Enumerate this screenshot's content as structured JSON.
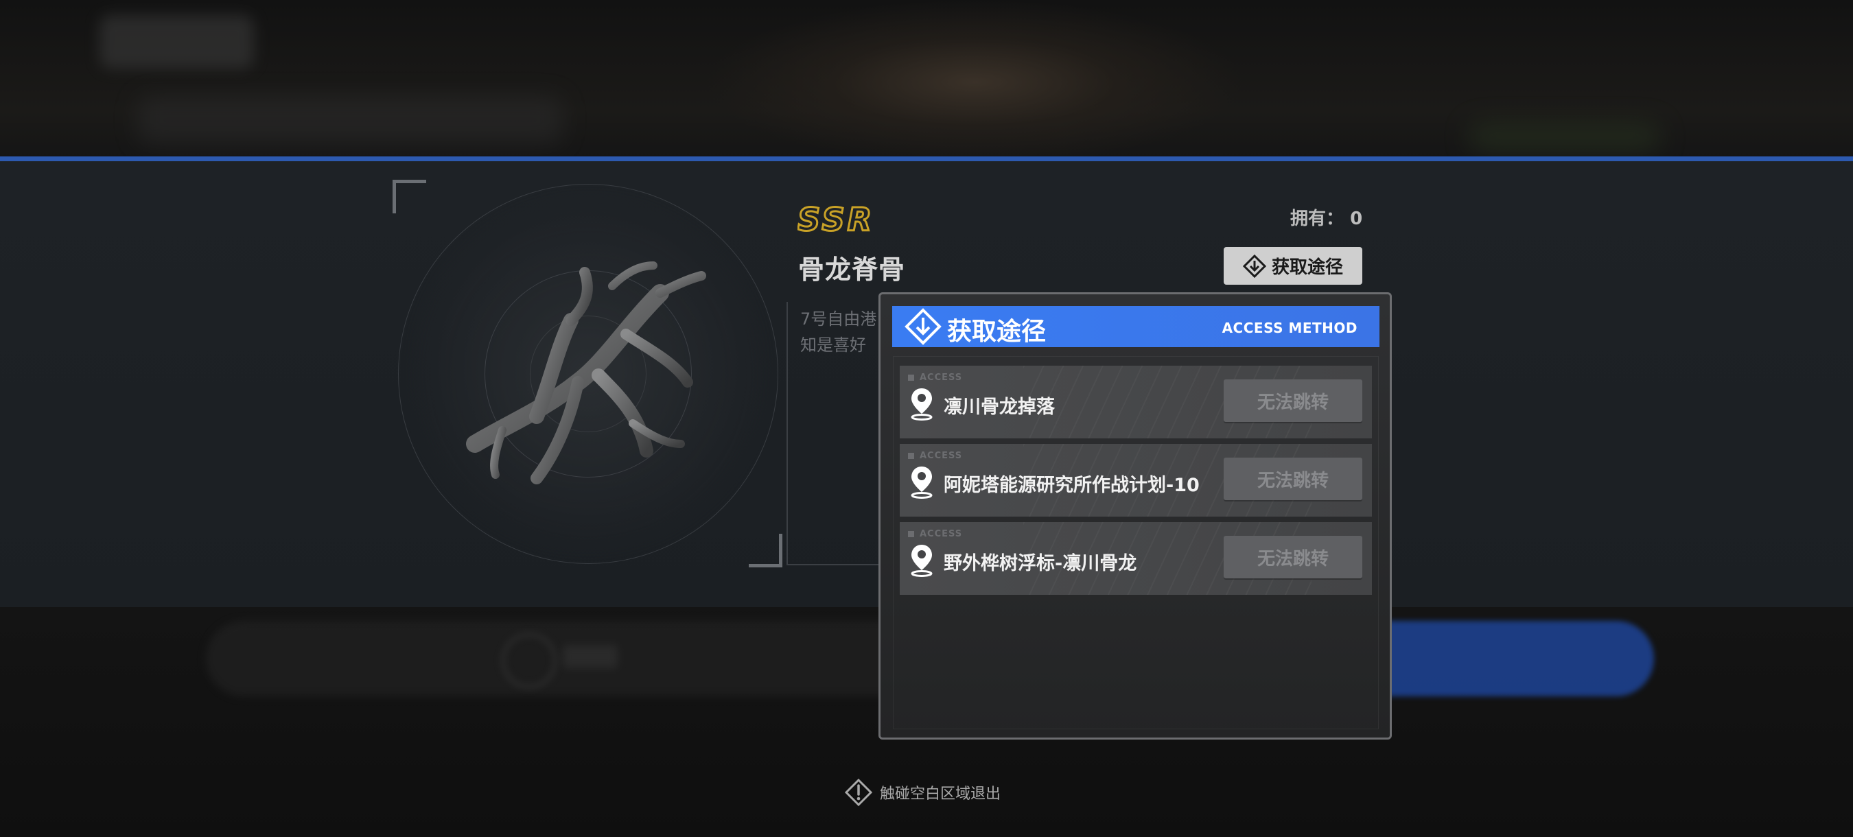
{
  "item": {
    "rarity": "SSR",
    "name": "骨龙脊骨",
    "owned_label": "拥有：",
    "owned_count": "0",
    "description_lines": [
      "7号自由港",
      "知是喜好"
    ],
    "access_button_label": "获取途径"
  },
  "popup": {
    "title": "获取途径",
    "subtitle": "ACCESS METHOD",
    "sources": [
      {
        "tag": "ACCESS",
        "label": "凛川骨龙掉落",
        "button": "无法跳转"
      },
      {
        "tag": "ACCESS",
        "label": "阿妮塔能源研究所作战计划-10",
        "button": "无法跳转"
      },
      {
        "tag": "ACCESS",
        "label": "野外桦树浮标-凛川骨龙",
        "button": "无法跳转"
      }
    ]
  },
  "footer": {
    "exit_hint": "触碰空白区域退出"
  },
  "colors": {
    "accent_blue": "#3a7cf2",
    "rarity_gold": "#c9a227",
    "divider_blue": "#2d5ab0"
  },
  "icons": {
    "access": "diamond-arrow-icon",
    "source": "location-pin-icon",
    "hint": "warning-diamond-icon"
  }
}
